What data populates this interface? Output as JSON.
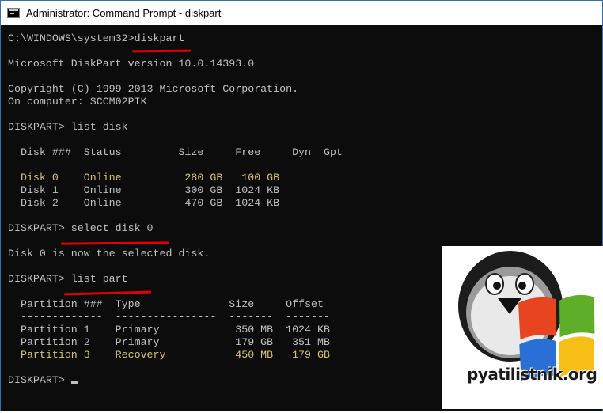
{
  "window": {
    "title": "Administrator: Command Prompt - diskpart"
  },
  "console": {
    "lines": [
      {
        "text": "C:\\WINDOWS\\system32>diskpart",
        "color": "normal"
      },
      {
        "text": "",
        "color": "normal"
      },
      {
        "text": "Microsoft DiskPart version 10.0.14393.0",
        "color": "normal"
      },
      {
        "text": "",
        "color": "normal"
      },
      {
        "text": "Copyright (C) 1999-2013 Microsoft Corporation.",
        "color": "normal"
      },
      {
        "text": "On computer: SCCM02PIK",
        "color": "normal"
      },
      {
        "text": "",
        "color": "normal"
      },
      {
        "text": "DISKPART> list disk",
        "color": "normal"
      },
      {
        "text": "",
        "color": "normal"
      },
      {
        "text": "  Disk ###  Status         Size     Free     Dyn  Gpt",
        "color": "normal"
      },
      {
        "text": "  --------  -------------  -------  -------  ---  ---",
        "color": "normal"
      },
      {
        "text": "  Disk 0    Online          280 GB   100 GB",
        "color": "yellow"
      },
      {
        "text": "  Disk 1    Online          300 GB  1024 KB",
        "color": "normal"
      },
      {
        "text": "  Disk 2    Online          470 GB  1024 KB",
        "color": "normal"
      },
      {
        "text": "",
        "color": "normal"
      },
      {
        "text": "DISKPART> select disk 0",
        "color": "normal"
      },
      {
        "text": "",
        "color": "normal"
      },
      {
        "text": "Disk 0 is now the selected disk.",
        "color": "normal"
      },
      {
        "text": "",
        "color": "normal"
      },
      {
        "text": "DISKPART> list part",
        "color": "normal"
      },
      {
        "text": "",
        "color": "normal"
      },
      {
        "text": "  Partition ###  Type              Size     Offset",
        "color": "normal"
      },
      {
        "text": "  -------------  ----------------  -------  -------",
        "color": "normal"
      },
      {
        "text": "  Partition 1    Primary            350 MB  1024 KB",
        "color": "normal"
      },
      {
        "text": "  Partition 2    Primary            179 GB   351 MB",
        "color": "normal"
      },
      {
        "text": "  Partition 3    Recovery           450 MB   179 GB",
        "color": "yellow"
      },
      {
        "text": "",
        "color": "normal"
      },
      {
        "text": "DISKPART> ",
        "color": "normal",
        "cursor": true
      }
    ]
  },
  "logo": {
    "text": "pyatilistnik.org"
  },
  "colors": {
    "console_bg": "#0c0c0c",
    "console_text": "#c0c0c0",
    "highlight_text": "#d5c372",
    "underline": "#e00000"
  }
}
